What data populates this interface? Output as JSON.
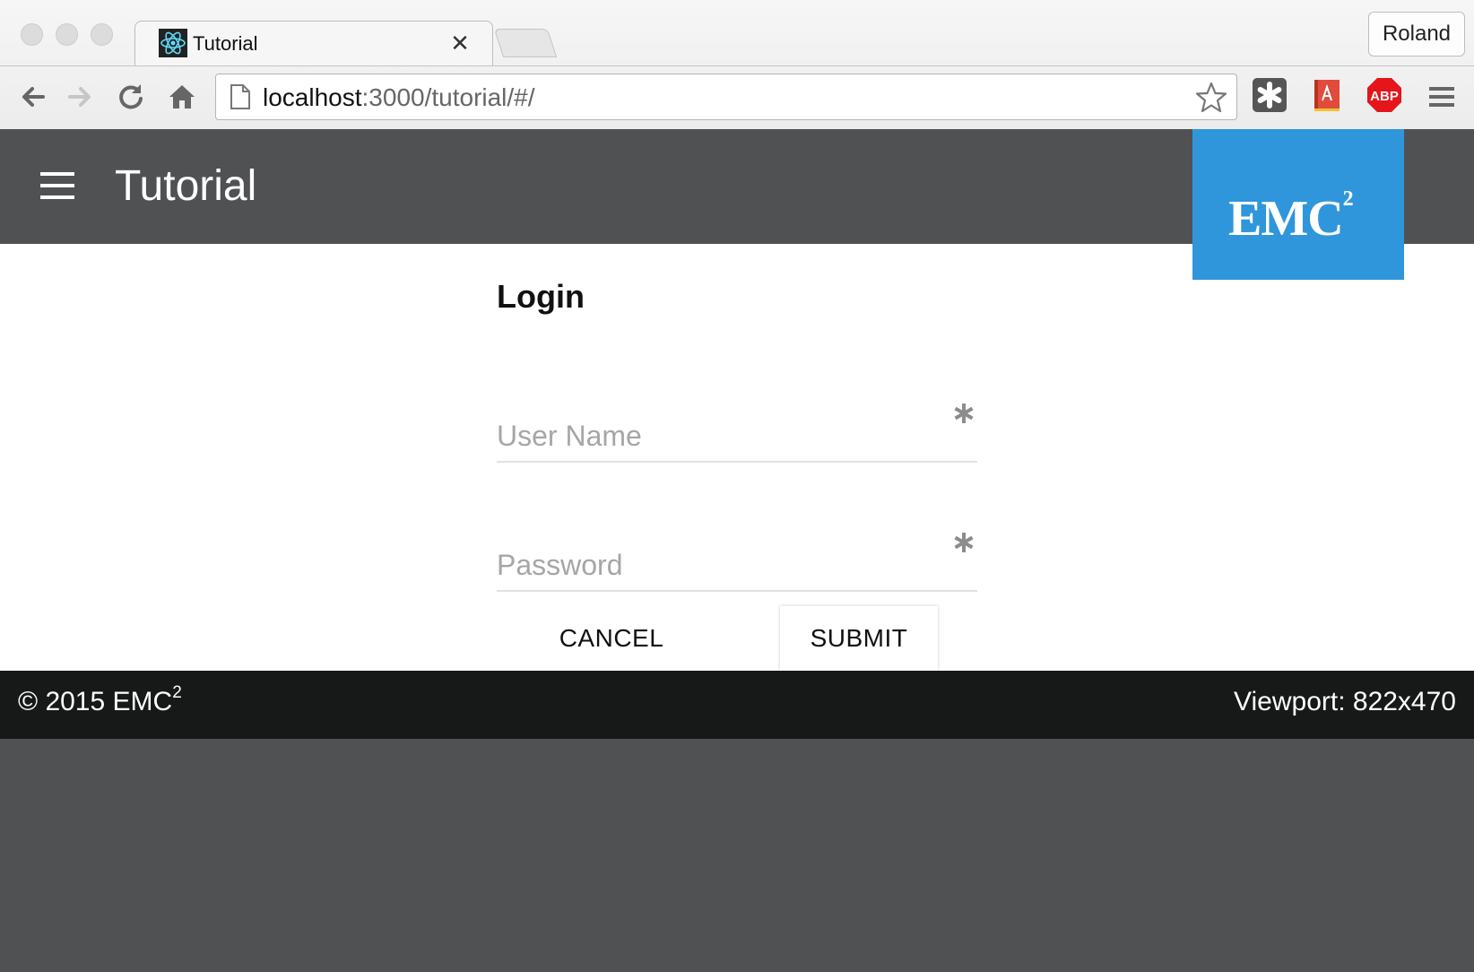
{
  "browser": {
    "tab": {
      "title": "Tutorial",
      "favicon": "react-atom-icon",
      "close_glyph": "✕"
    },
    "profile_name": "Roland",
    "url": {
      "host": "localhost",
      "rest": ":3000/tutorial/#/"
    },
    "toolbar_icons": [
      "back-icon",
      "forward-icon",
      "reload-icon",
      "home-icon",
      "bookmark-star-icon",
      "extension-puzzle-icon",
      "acrobat-extension-icon",
      "adblock-plus-icon",
      "chrome-menu-icon"
    ],
    "adblock_label": "ABP"
  },
  "app": {
    "title": "Tutorial",
    "logo": {
      "text": "EMC",
      "superscript": "2",
      "background": "#3096db"
    },
    "header_color": "#505153"
  },
  "login": {
    "title": "Login",
    "username": {
      "placeholder": "User Name",
      "value": ""
    },
    "password": {
      "placeholder": "Password",
      "value": ""
    },
    "cancel_label": "CANCEL",
    "submit_label": "SUBMIT"
  },
  "footer": {
    "copyright_prefix": "© 2015 EMC",
    "copyright_sup": "2",
    "viewport": "Viewport: 822x470",
    "background": "#171919"
  }
}
